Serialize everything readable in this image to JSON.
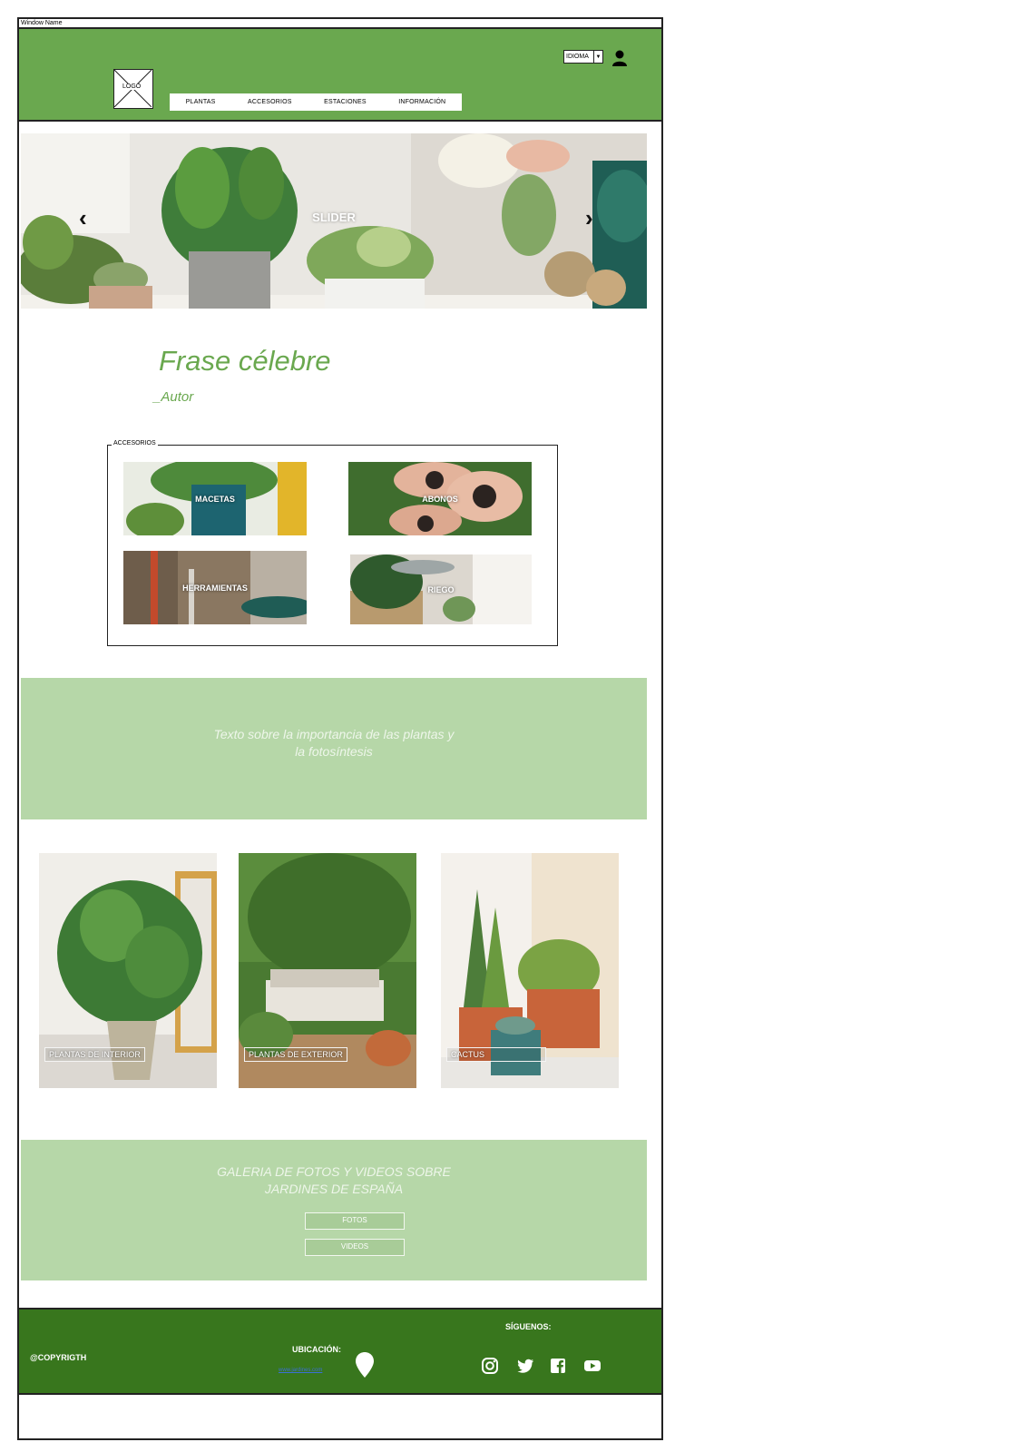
{
  "window": {
    "title": "Window Name"
  },
  "header": {
    "logo_text": "LOGO",
    "nav": [
      "PLANTAS",
      "ACCESORIOS",
      "ESTACIONES",
      "INFORMACIÓN"
    ],
    "language_select": "IDIOMA"
  },
  "slider": {
    "label": "SLIDER",
    "prev": "‹",
    "next": "›"
  },
  "quote": {
    "text": "Frase célebre",
    "author": "_Autor"
  },
  "accessories": {
    "legend": "ACCESORIOS",
    "items": [
      "MACETAS",
      "ABONOS",
      "HERRAMIENTAS",
      "RIEGO"
    ]
  },
  "info_band": {
    "line1": "Texto sobre la importancia de las plantas y",
    "line2": "la fotosíntesis"
  },
  "plant_categories": [
    "PLANTAS DE INTERIOR",
    "PLANTAS DE EXTERIOR",
    "CACTUS"
  ],
  "gallery": {
    "line1": "GALERIA DE FOTOS Y VIDEOS SOBRE",
    "line2": "JARDINES DE ESPAÑA",
    "buttons": [
      "FOTOS",
      "VIDEOS"
    ]
  },
  "footer": {
    "copyright": "@COPYRIGTH",
    "location_label": "UBICACIÓN:",
    "location_link": "www.jardines.com",
    "follow_label": "SÍGUENOS:"
  },
  "colors": {
    "header_green": "#6aa84f",
    "band_green": "#b6d7a8",
    "footer_green": "#38761d"
  },
  "icons": [
    "user-icon",
    "chevron-left-icon",
    "chevron-right-icon",
    "map-pin-icon",
    "instagram-icon",
    "twitter-icon",
    "facebook-icon",
    "youtube-icon"
  ]
}
